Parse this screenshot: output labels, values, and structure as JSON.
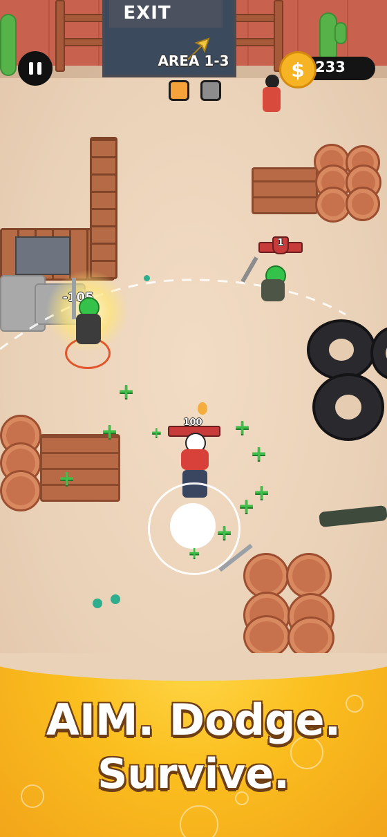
{
  "hud": {
    "exit_label": "EXIT",
    "area_label": "AREA 1-3",
    "coin_symbol": "$",
    "coin_count": "233",
    "pause_icon": "pause-icon",
    "area_progress_colors": [
      "#f5a23a",
      "#8c8c8c"
    ]
  },
  "game": {
    "player_hp": "100",
    "enemy_level": "1",
    "damage_popup": "-105"
  },
  "banner": {
    "line1": "AIM. Dodge.",
    "line2": "Survive."
  },
  "colors": {
    "heal_plus": "#3fbf4a",
    "banner_yellow": "#fbbf1f",
    "hp_red": "#c73b3b"
  }
}
